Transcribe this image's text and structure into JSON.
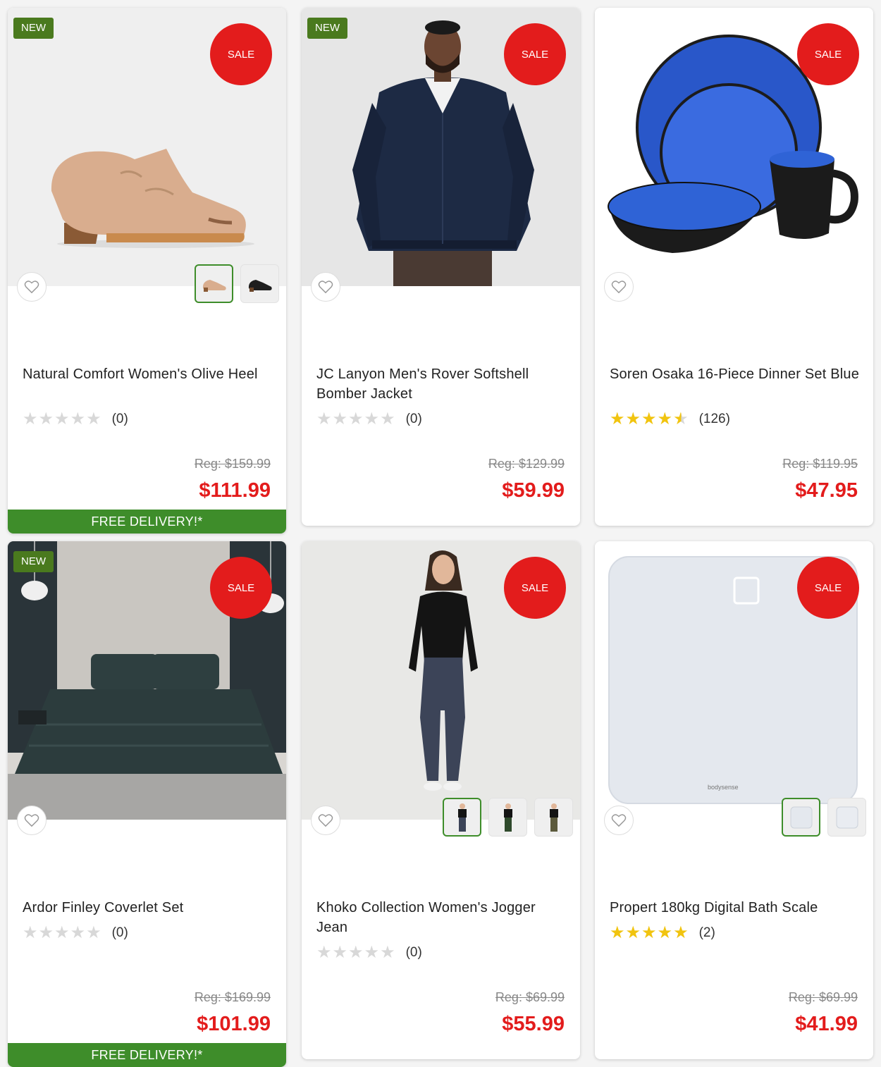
{
  "colors": {
    "sale_red": "#e31c1c",
    "new_green": "#4a7a1e",
    "delivery_green": "#3e8d2a",
    "star_gold": "#f1c40f"
  },
  "products": [
    {
      "badge_new": "NEW",
      "badge_sale": "SALE",
      "title": "Natural Comfort Women's Olive Heel",
      "rating": 0,
      "rating_count": "(0)",
      "reg_price": "Reg: $159.99",
      "price": "$111.99",
      "delivery": "FREE DELIVERY!*",
      "thumbnail_count": 2,
      "wishlist_icon": "heart-icon"
    },
    {
      "badge_new": "NEW",
      "badge_sale": "SALE",
      "title": "JC Lanyon Men's Rover Softshell Bomber Jacket",
      "rating": 0,
      "rating_count": "(0)",
      "reg_price": "Reg: $129.99",
      "price": "$59.99",
      "wishlist_icon": "heart-icon"
    },
    {
      "badge_sale": "SALE",
      "title": "Soren Osaka 16-Piece Dinner Set Blue",
      "rating": 4.5,
      "rating_count": "(126)",
      "reg_price": "Reg: $119.95",
      "price": "$47.95",
      "wishlist_icon": "heart-icon"
    },
    {
      "badge_new": "NEW",
      "badge_sale": "SALE",
      "title": "Ardor Finley Coverlet Set",
      "rating": 0,
      "rating_count": "(0)",
      "reg_price": "Reg: $169.99",
      "price": "$101.99",
      "delivery": "FREE DELIVERY!*",
      "wishlist_icon": "heart-icon"
    },
    {
      "badge_sale": "SALE",
      "title": "Khoko Collection Women's Jogger Jean",
      "rating": 0,
      "rating_count": "(0)",
      "reg_price": "Reg: $69.99",
      "price": "$55.99",
      "thumbnail_count": 3,
      "wishlist_icon": "heart-icon"
    },
    {
      "badge_sale": "SALE",
      "title": "Propert 180kg Digital Bath Scale",
      "rating": 5,
      "rating_count": "(2)",
      "reg_price": "Reg: $69.99",
      "price": "$41.99",
      "thumbnail_count": 2,
      "brand_mark": "bodysense",
      "wishlist_icon": "heart-icon"
    }
  ]
}
